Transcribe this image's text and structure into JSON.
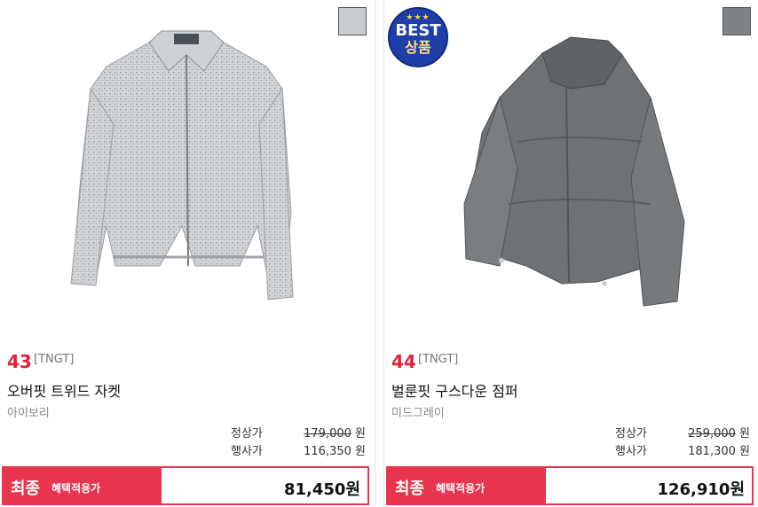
{
  "products": [
    {
      "rank": "43",
      "brand": "[TNGT]",
      "name": "오버핏 트위드 자켓",
      "color": "아이보리",
      "regular_label": "정상가",
      "regular_price": "179,000",
      "event_label": "행사가",
      "event_price": "116,350 원",
      "won": "원",
      "final_label": "최종",
      "final_sub": "혜택적용가",
      "final_price": "81,450원",
      "swatch_color": "#c9ccd0",
      "best": false
    },
    {
      "rank": "44",
      "brand": "[TNGT]",
      "name": "벌룬핏 구스다운 점퍼",
      "color": "미드그레이",
      "regular_label": "정상가",
      "regular_price": "259,000",
      "event_label": "행사가",
      "event_price": "181,300 원",
      "won": "원",
      "final_label": "최종",
      "final_sub": "혜택적용가",
      "final_price": "126,910원",
      "swatch_color": "#7f8284",
      "best": true,
      "best_badge": {
        "stars": "★★★",
        "text": "BEST",
        "sub": "상품"
      }
    }
  ],
  "colors": {
    "accent": "#e8344e",
    "rank": "#e4213b",
    "badge": "#1f3fa8"
  }
}
